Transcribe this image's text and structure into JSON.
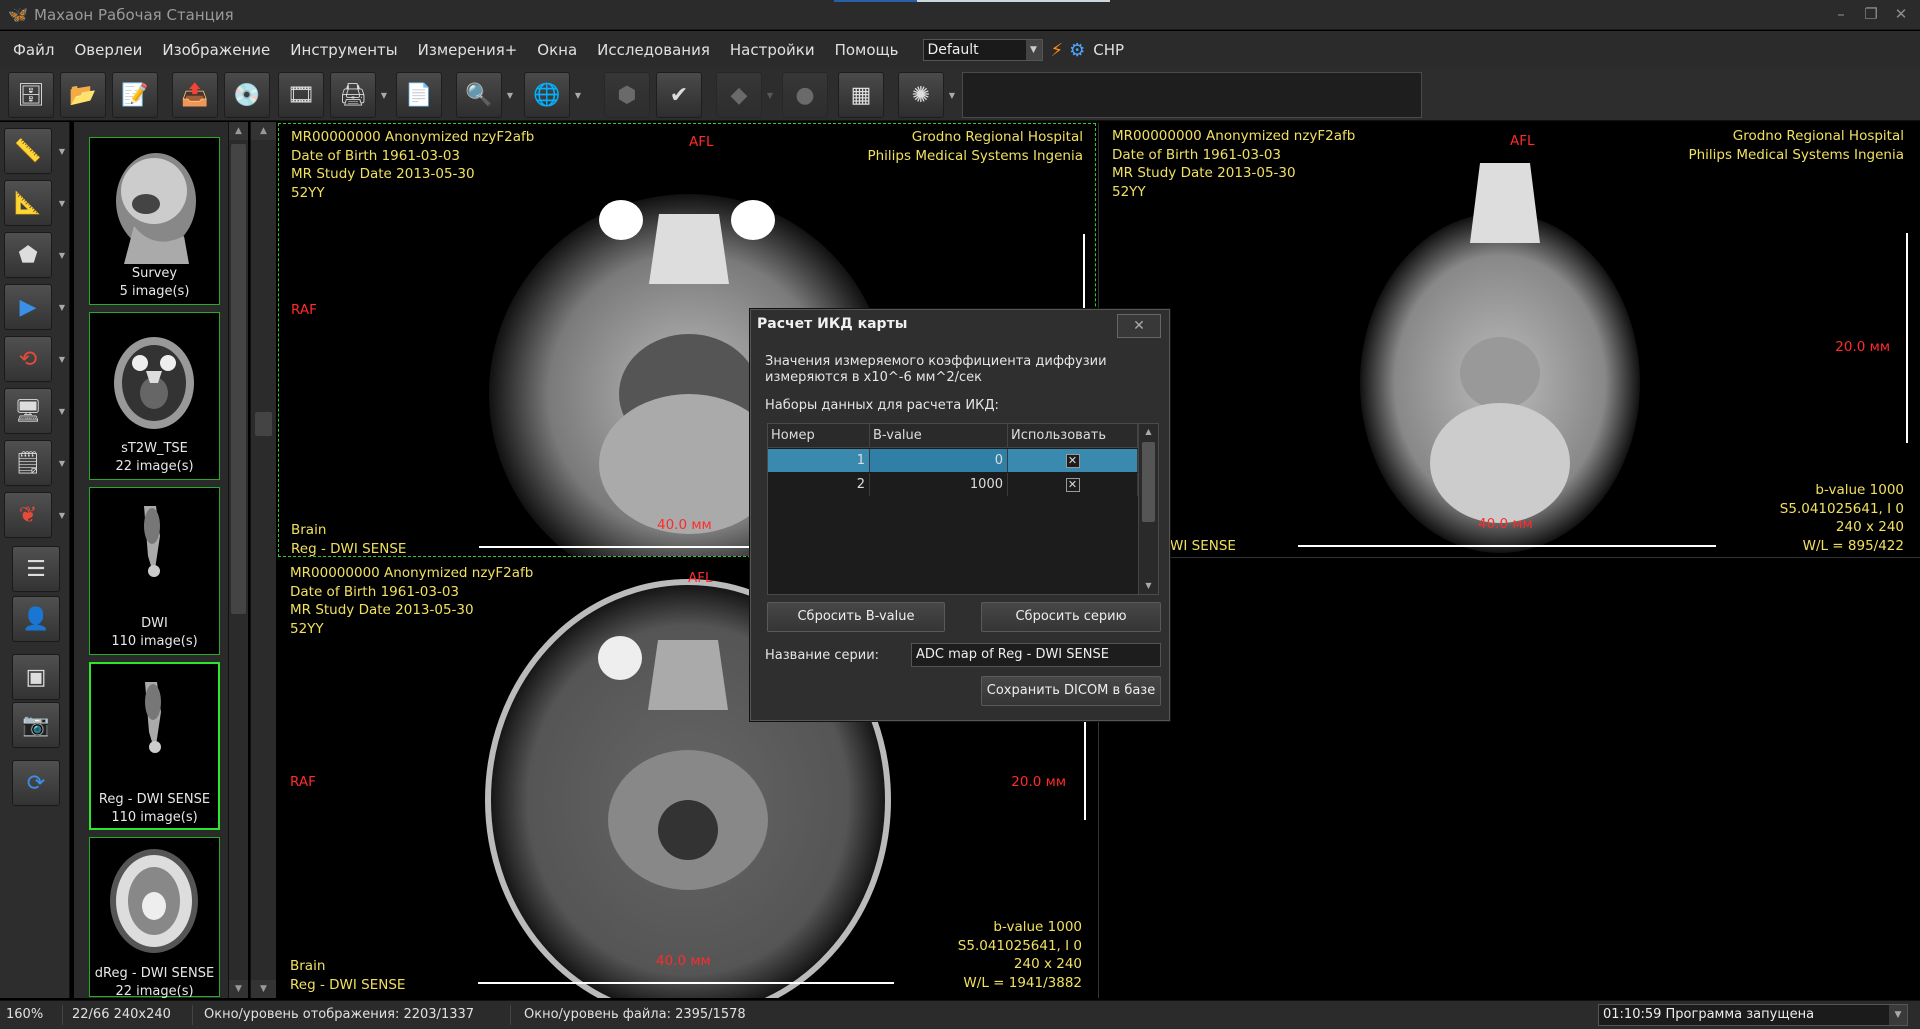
{
  "window": {
    "title": "Махаон Рабочая Станция",
    "minimize": "–",
    "restore": "❐",
    "close": "✕"
  },
  "menu": [
    "Файл",
    "Оверлеи",
    "Изображение",
    "Инструменты",
    "Измерения+",
    "Окна",
    "Исследования",
    "Настройки",
    "Помощь"
  ],
  "preset": "Default",
  "language": "СНР",
  "series_thumbs": [
    {
      "name": "Survey",
      "count": "5 image(s)"
    },
    {
      "name": "sT2W_TSE",
      "count": "22 image(s)"
    },
    {
      "name": "DWI",
      "count": "110 image(s)"
    },
    {
      "name": "Reg - DWI SENSE",
      "count": "110 image(s)"
    },
    {
      "name": "dReg - DWI SENSE",
      "count": "22 image(s)"
    }
  ],
  "viewports": {
    "top_left": {
      "patient": [
        "MR00000000 Anonymized nzyF2afb",
        "Date of Birth 1961-03-03",
        "MR Study Date 2013-05-30",
        "52YY"
      ],
      "hospital": [
        "Grodno Regional Hospital",
        "Philips Medical Systems Ingenia"
      ],
      "orient_top": "AFL",
      "orient_left": "RAF",
      "bottom_left": [
        "Brain",
        "Reg - DWI SENSE"
      ],
      "scale_label": "40.0 мм"
    },
    "top_right": {
      "patient": [
        "MR00000000 Anonymized nzyF2afb",
        "Date of Birth 1961-03-03",
        "MR Study Date 2013-05-30",
        "52YY"
      ],
      "hospital": [
        "Grodno Regional Hospital",
        "Philips Medical Systems Ingenia"
      ],
      "orient_top": "AFL",
      "scale_v_label": "20.0 мм",
      "scale_label": "40.0 мм",
      "bottom_left": "WI SENSE",
      "bottom_right": [
        "b-value 1000",
        "S5.041025641, I 0",
        "240 x 240",
        "W/L = 895/422"
      ]
    },
    "bottom_left": {
      "patient": [
        "MR00000000 Anonymized nzyF2afb",
        "Date of Birth 1961-03-03",
        "MR Study Date 2013-05-30",
        "52YY"
      ],
      "orient_top": "AFL",
      "orient_left": "RAF",
      "scale_v_label": "20.0 мм",
      "scale_label": "40.0 мм",
      "bottom_left": [
        "Brain",
        "Reg - DWI SENSE"
      ],
      "bottom_right": [
        "b-value 1000",
        "S5.041025641, I 0",
        "240 x 240",
        "W/L = 1941/3882"
      ]
    }
  },
  "dialog": {
    "title": "Расчет ИКД карты",
    "desc_line1": "Значения измеряемого коэффициента диффузии",
    "desc_line2": "измеряются в  x10^-6 мм^2/сек",
    "datasets_label": "Наборы данных для расчета ИКД:",
    "columns": [
      "Номер",
      "B-value",
      "Использовать"
    ],
    "rows": [
      {
        "num": "1",
        "bvalue": "0",
        "use": "✕"
      },
      {
        "num": "2",
        "bvalue": "1000",
        "use": "✕"
      }
    ],
    "reset_bvalue": "Сбросить B-value",
    "reset_series": "Сбросить серию",
    "series_name_label": "Название серии:",
    "series_name_value": "ADC map of Reg - DWI SENSE",
    "save_button": "Сохранить DICOM в базе"
  },
  "status": {
    "zoom": "160%",
    "image_info": "22/66 240x240",
    "display_wl": "Окно/уровень отображения: 2203/1337",
    "file_wl": "Окно/уровень файла: 2395/1578",
    "message": "01:10:59 Программа запущена"
  }
}
